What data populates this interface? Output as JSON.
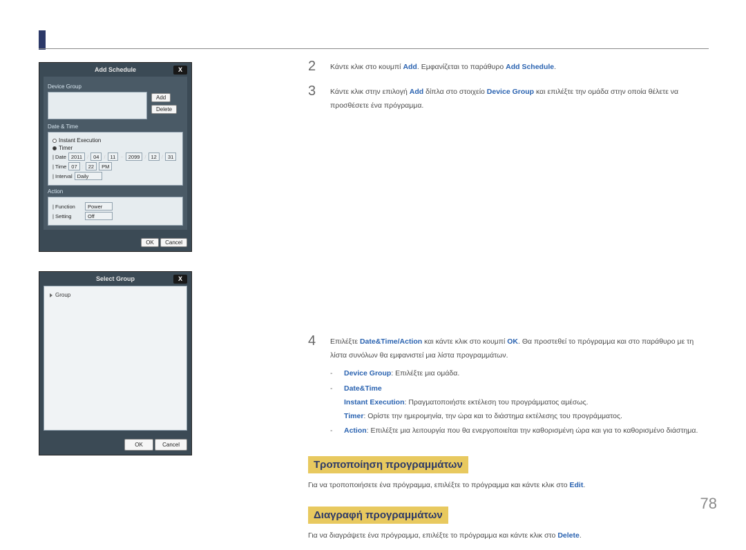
{
  "page_number": "78",
  "dialog1": {
    "title": "Add Schedule",
    "close": "X",
    "device_group_label": "Device Group",
    "add_btn": "Add",
    "delete_btn": "Delete",
    "datetime_label": "Date & Time",
    "instant_exec": "Instant Execution",
    "timer": "Timer",
    "date_label": "| Date",
    "date_y": "2011",
    "date_m": "04",
    "date_d": "11",
    "date_y2": "2099",
    "date_m2": "12",
    "date_d2": "31",
    "time_label": "| Time",
    "time_h": "07",
    "time_m": "22",
    "time_ap": "PM",
    "interval_label": "| Interval",
    "interval_val": "Daily",
    "action_label": "Action",
    "function_label": "| Function",
    "function_val": "Power",
    "setting_label": "| Setting",
    "setting_val": "Off",
    "ok": "OK",
    "cancel": "Cancel"
  },
  "dialog2": {
    "title": "Select Group",
    "close": "X",
    "group": "Group",
    "ok": "OK",
    "cancel": "Cancel"
  },
  "steps": {
    "n2": "2",
    "s2_a": "Κάντε κλικ στο κουμπί ",
    "s2_add": "Add",
    "s2_b": ". Εμφανίζεται το παράθυρο ",
    "s2_as": "Add Schedule",
    "s2_c": ".",
    "n3": "3",
    "s3_a": "Κάντε κλικ στην επιλογή ",
    "s3_add": "Add",
    "s3_b": " δίπλα στο στοιχείο ",
    "s3_dg": "Device Group",
    "s3_c": " και επιλέξτε την ομάδα στην οποία θέλετε να προσθέσετε ένα πρόγραμμα.",
    "n4": "4",
    "s4_a": "Επιλέξτε ",
    "s4_dta": "Date&Time/Action",
    "s4_b": " και κάντε κλικ στο κουμπί ",
    "s4_ok": "OK",
    "s4_c": ". Θα προστεθεί το πρόγραμμα και στο παράθυρο με τη λίστα συνόλων θα εμφανιστεί μια λίστα προγραμμάτων.",
    "sub_dg": "Device Group",
    "sub_dg_txt": ": Επιλέξτε μια ομάδα.",
    "sub_dt": "Date&Time",
    "sub_ie": "Instant Execution",
    "sub_ie_txt": ": Πραγματοποιήστε εκτέλεση του προγράμματος αμέσως.",
    "sub_tm": "Timer",
    "sub_tm_txt": ": Ορίστε την ημερομηνία, την ώρα και το διάστημα εκτέλεσης του προγράμματος.",
    "sub_ac": "Action",
    "sub_ac_txt": ": Επιλέξτε μια λειτουργία που θα ενεργοποιείται την καθορισμένη ώρα και για το καθορισμένο διάστημα."
  },
  "h_modify": "Τροποποίηση προγραμμάτων",
  "p_modify_a": "Για να τροποποιήσετε ένα πρόγραμμα, επιλέξτε το πρόγραμμα και κάντε κλικ στο ",
  "p_modify_edit": "Edit",
  "p_modify_b": ".",
  "h_delete": "Διαγραφή προγραμμάτων",
  "p_delete_a": "Για να διαγράψετε ένα πρόγραμμα, επιλέξτε το πρόγραμμα και κάντε κλικ στο ",
  "p_delete_del": "Delete",
  "p_delete_b": "."
}
